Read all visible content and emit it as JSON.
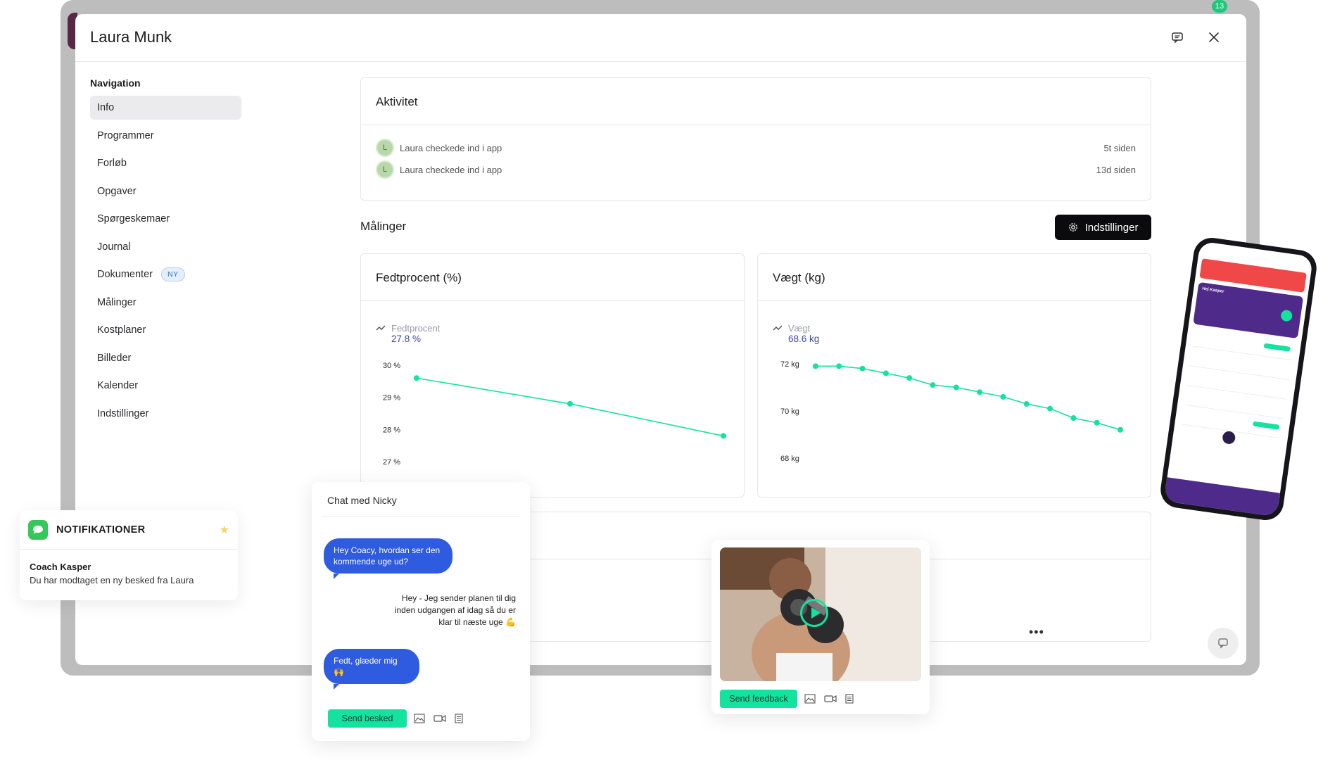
{
  "modal": {
    "title": "Laura Munk",
    "backdrop_badge": "13"
  },
  "nav": {
    "heading": "Navigation",
    "items": [
      {
        "label": "Info",
        "active": true
      },
      {
        "label": "Programmer"
      },
      {
        "label": "Forløb"
      },
      {
        "label": "Opgaver"
      },
      {
        "label": "Spørgeskemaer"
      },
      {
        "label": "Journal"
      },
      {
        "label": "Dokumenter",
        "badge": "NY"
      },
      {
        "label": "Målinger"
      },
      {
        "label": "Kostplaner"
      },
      {
        "label": "Billeder"
      },
      {
        "label": "Kalender"
      },
      {
        "label": "Indstillinger"
      }
    ]
  },
  "activity": {
    "title": "Aktivitet",
    "rows": [
      {
        "avatar": "L",
        "text": "Laura checkede ind i app",
        "time": "5t siden"
      },
      {
        "avatar": "L",
        "text": "Laura checkede ind i app",
        "time": "13d siden"
      }
    ]
  },
  "measurements": {
    "title": "Målinger",
    "settings_label": "Indstillinger"
  },
  "chart_data": [
    {
      "type": "line",
      "title": "Fedtprocent (%)",
      "series": [
        {
          "name": "Fedtprocent",
          "values": [
            29.6,
            28.8,
            27.8
          ]
        }
      ],
      "x": [
        1,
        2,
        3
      ],
      "legend_value": "27.8 %",
      "ylim": [
        27,
        30
      ],
      "yticks": [
        "30 %",
        "29 %",
        "28 %",
        "27 %"
      ],
      "color": "#14e3a0"
    },
    {
      "type": "line",
      "title": "Vægt (kg)",
      "series": [
        {
          "name": "Vægt",
          "values": [
            71.9,
            71.9,
            71.8,
            71.6,
            71.4,
            71.1,
            71.0,
            70.8,
            70.6,
            70.3,
            70.1,
            69.7,
            69.5,
            69.2
          ]
        }
      ],
      "x": [
        1,
        2,
        3,
        4,
        5,
        6,
        7,
        8,
        9,
        10,
        11,
        12,
        13,
        14
      ],
      "legend_value": "68.6 kg",
      "ylim": [
        68,
        72
      ],
      "yticks": [
        "72 kg",
        "70 kg",
        "68 kg"
      ],
      "color": "#14e3a0"
    }
  ],
  "notification": {
    "title": "NOTIFIKATIONER",
    "sender": "Coach Kasper",
    "message": "Du har modtaget en ny besked fra Laura"
  },
  "chat": {
    "title": "Chat med Nicky",
    "message_1": "Hey Coacy, hvordan ser den kommende uge ud?",
    "message_2": "Hey - Jeg sender planen til dig inden udgangen af idag så du er klar til næste uge 💪",
    "message_3": "Fedt, glæder mig 🙌",
    "send_label": "Send besked"
  },
  "video": {
    "send_label": "Send feedback"
  },
  "phone": {
    "greeting": "Hej Kasper"
  },
  "colors": {
    "accent": "#14e3a0",
    "bubble": "#2f5be0",
    "backdrop": "#bdbdbd",
    "alert": "#f04848",
    "phone_brand": "#4e2a8a"
  }
}
